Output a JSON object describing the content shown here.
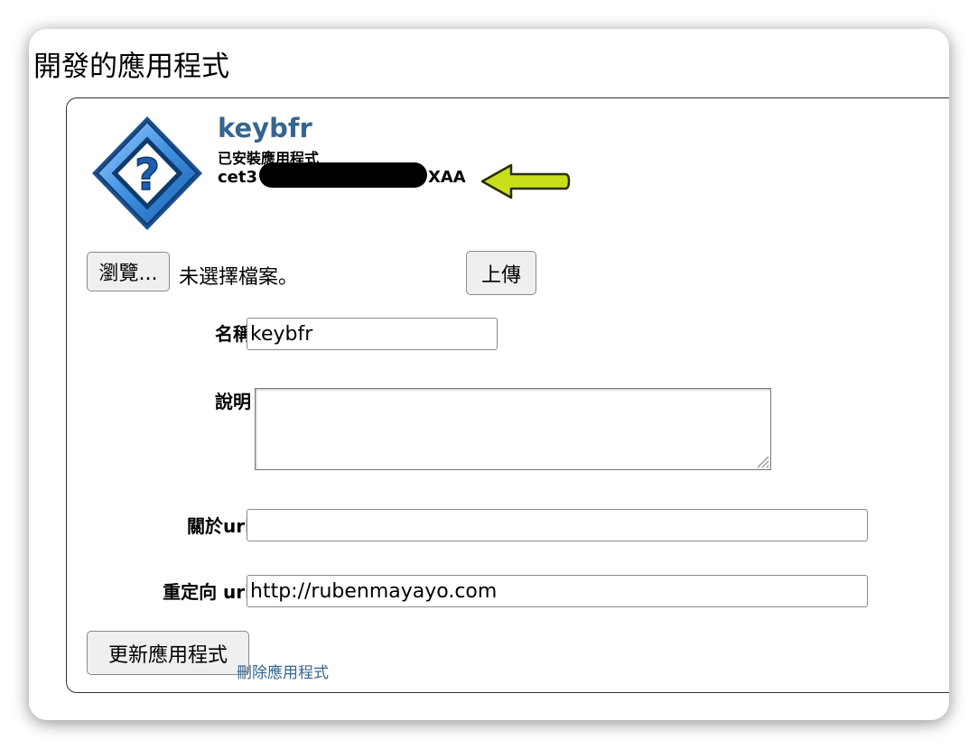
{
  "page": {
    "title": "開發的應用程式"
  },
  "app": {
    "name": "keybfr",
    "status": "已安裝應用程式",
    "id_prefix": "cet3",
    "id_suffix": "XAA",
    "icon": "question-diamond-icon"
  },
  "upload": {
    "browse_label": "瀏覽...",
    "no_file_text": "未選擇檔案。",
    "upload_label": "上傳"
  },
  "form": {
    "name_label": "名稱",
    "name_value": "keybfr",
    "description_label": "說明",
    "description_value": "",
    "about_url_label": "關於url",
    "about_url_value": "",
    "redirect_uri_label": "重定向 uri",
    "redirect_uri_value": "http://rubenmayayo.com"
  },
  "actions": {
    "update_label": "更新應用程式",
    "delete_label": "刪除應用程式"
  },
  "colors": {
    "link": "#36658f",
    "annotation_arrow": "#c8e01a",
    "icon_blue": "#2f7fd0"
  }
}
